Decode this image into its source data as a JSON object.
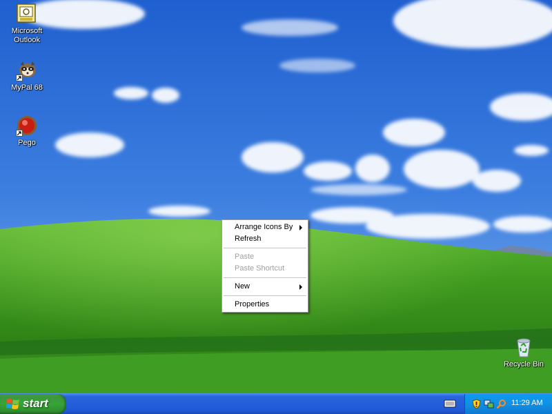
{
  "desktop": {
    "icons": [
      {
        "label": "Microsoft Outlook",
        "icon": "outlook-icon"
      },
      {
        "label": "MyPal 68",
        "icon": "mypal-icon"
      },
      {
        "label": "Pego",
        "icon": "pego-icon"
      },
      {
        "label": "Recycle Bin",
        "icon": "recycle-bin-icon"
      }
    ]
  },
  "context_menu": {
    "items": [
      {
        "label": "Arrange Icons By",
        "submenu": true,
        "enabled": true
      },
      {
        "label": "Refresh",
        "submenu": false,
        "enabled": true
      },
      {
        "label": "Paste",
        "submenu": false,
        "enabled": false
      },
      {
        "label": "Paste Shortcut",
        "submenu": false,
        "enabled": false
      },
      {
        "label": "New",
        "submenu": true,
        "enabled": true
      },
      {
        "label": "Properties",
        "submenu": false,
        "enabled": true
      }
    ]
  },
  "taskbar": {
    "start_label": "start",
    "language_icon": "keyboard-icon",
    "tray_icons": [
      "security-shield-icon",
      "network-icon",
      "search-icon"
    ],
    "clock": "11:29 AM"
  },
  "colors": {
    "taskbar_blue": "#245edb",
    "start_green": "#37a437",
    "tray_blue": "#1190e3",
    "sky": "#2f6fd8",
    "grass": "#3f9a1e"
  }
}
